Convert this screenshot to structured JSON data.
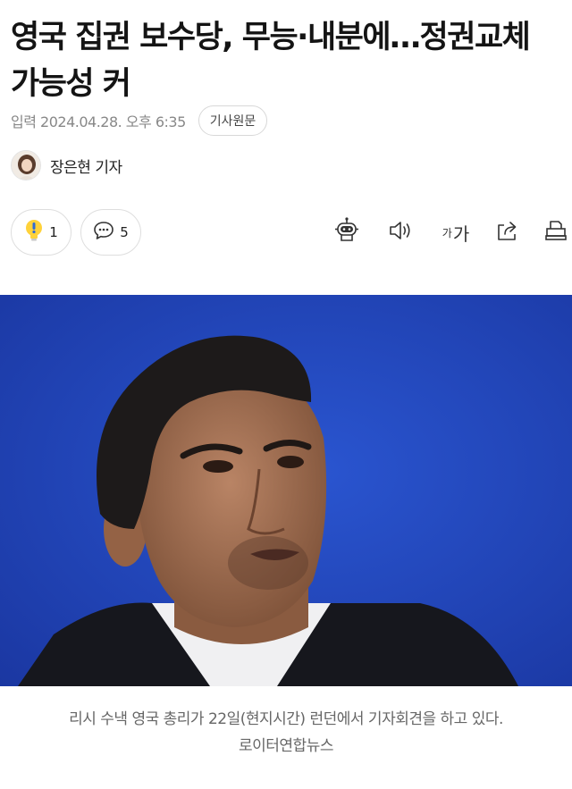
{
  "article": {
    "headline": "영국 집권 보수당, 무능·내분에…정권교체 가능성 커",
    "date": "입력 2024.04.28. 오후 6:35",
    "original_button": "기사원문",
    "reporter": "장은현 기자"
  },
  "actions": {
    "like_count": "1",
    "comment_count": "5",
    "font_small": "가",
    "font_big": "가"
  },
  "icons": {
    "like": "lightbulb-icon",
    "comment": "speech-bubble-icon",
    "robot": "robot-icon",
    "speaker": "speaker-icon",
    "share": "share-icon",
    "print": "print-icon"
  },
  "colors": {
    "photo_background": "#2244b8",
    "accent_yellow": "#ffd23a",
    "accent_blue": "#2f6bd6"
  },
  "photo": {
    "caption_line1": "리시 수낵 영국 총리가 22일(현지시간) 런던에서 기자회견을 하고 있다.",
    "caption_line2": "로이터연합뉴스"
  }
}
